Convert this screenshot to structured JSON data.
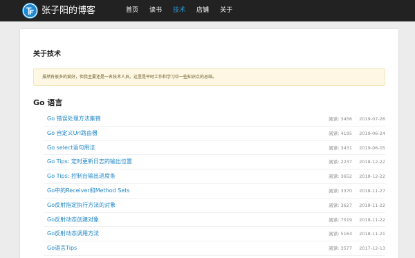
{
  "header": {
    "logo_icon": "tf-logo-icon",
    "site_title": "张子阳的博客",
    "nav": [
      {
        "label": "首页",
        "active": false
      },
      {
        "label": "读书",
        "active": false
      },
      {
        "label": "技术",
        "active": true
      },
      {
        "label": "店铺",
        "active": false
      },
      {
        "label": "关于",
        "active": false
      }
    ]
  },
  "colors": {
    "topbar": "#222222",
    "accent": "#2e9bd6",
    "link": "#1f86c8",
    "notice_bg": "#fdf7e3"
  },
  "main": {
    "page_title": "关于技术",
    "notice": "虽然有很多的爱好，但我主要还是一名技术人员。这里是平时工作和学习中一些知识点的总结。",
    "section_title": "Go 语言",
    "articles": [
      {
        "title": "Go 错误处理方法集锦",
        "views": "阅读: 3456",
        "date": "2019-07-26"
      },
      {
        "title": "Go 自定义Url路由器",
        "views": "阅读: 4195",
        "date": "2019-06-24"
      },
      {
        "title": "Go select语句用法",
        "views": "阅读: 3431",
        "date": "2019-06-05"
      },
      {
        "title": "Go Tips: 定时更新日志的输出位置",
        "views": "阅读: 2237",
        "date": "2018-12-22"
      },
      {
        "title": "Go Tips: 控制台输出进度条",
        "views": "阅读: 3652",
        "date": "2018-12-22"
      },
      {
        "title": "Go中的Receiver和Method Sets",
        "views": "阅读: 3370",
        "date": "2018-11-27"
      },
      {
        "title": "Go反射指定执行方法的对象",
        "views": "阅读: 3627",
        "date": "2018-11-22"
      },
      {
        "title": "Go反射动态创建对象",
        "views": "阅读: 7519",
        "date": "2018-11-22"
      },
      {
        "title": "Go反射动态调用方法",
        "views": "阅读: 5163",
        "date": "2018-11-21"
      },
      {
        "title": "Go语言Tips",
        "views": "阅读: 3577",
        "date": "2017-12-13"
      }
    ]
  }
}
